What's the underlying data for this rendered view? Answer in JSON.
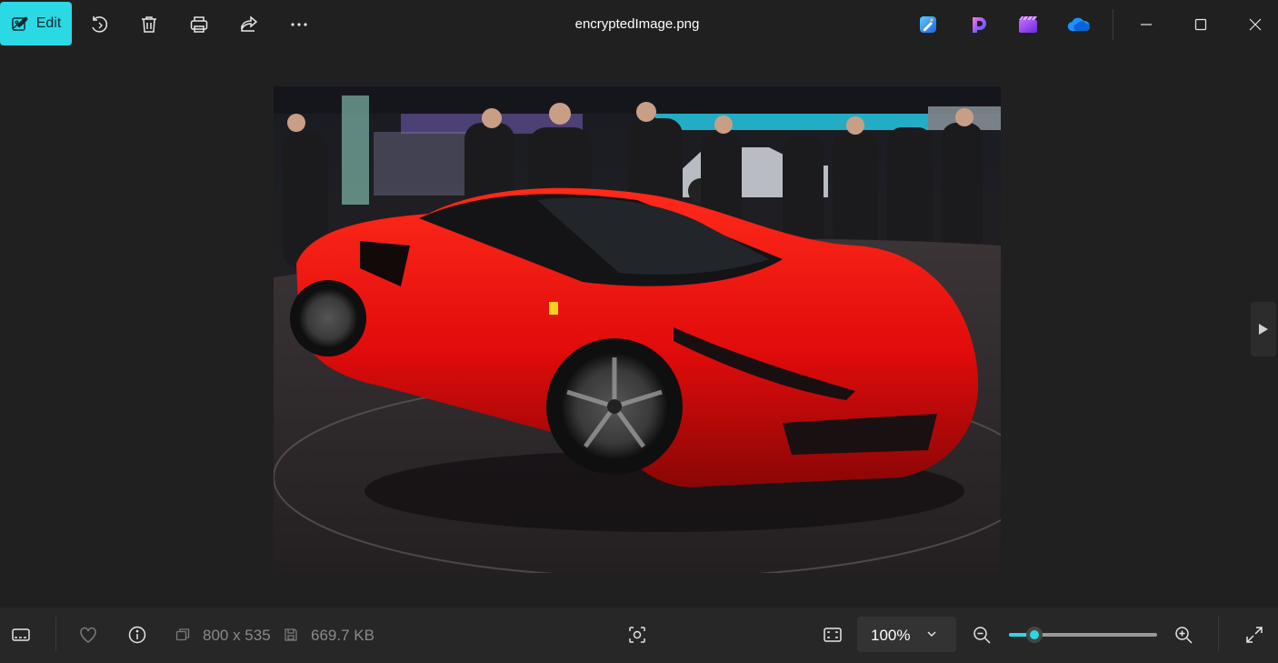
{
  "toolbar": {
    "edit_label": "Edit",
    "file_name": "encryptedImage.png"
  },
  "icons": {
    "rotate": "rotate-icon",
    "delete": "trash-icon",
    "print": "printer-icon",
    "share": "share-icon",
    "more": "more-icon",
    "designer": "designer-app-icon",
    "copilot": "clipchamp-app-icon",
    "clipchamp": "video-editor-app-icon",
    "onedrive": "onedrive-icon"
  },
  "photo": {
    "subject": "red sports car"
  },
  "status": {
    "dimensions": "800 x 535",
    "file_size": "669.7 KB"
  },
  "zoom": {
    "value_label": "100%",
    "level_fraction": 0.17
  },
  "colors": {
    "accent": "#2bd9e5",
    "background": "#202020",
    "bottom_bar": "#272727"
  }
}
